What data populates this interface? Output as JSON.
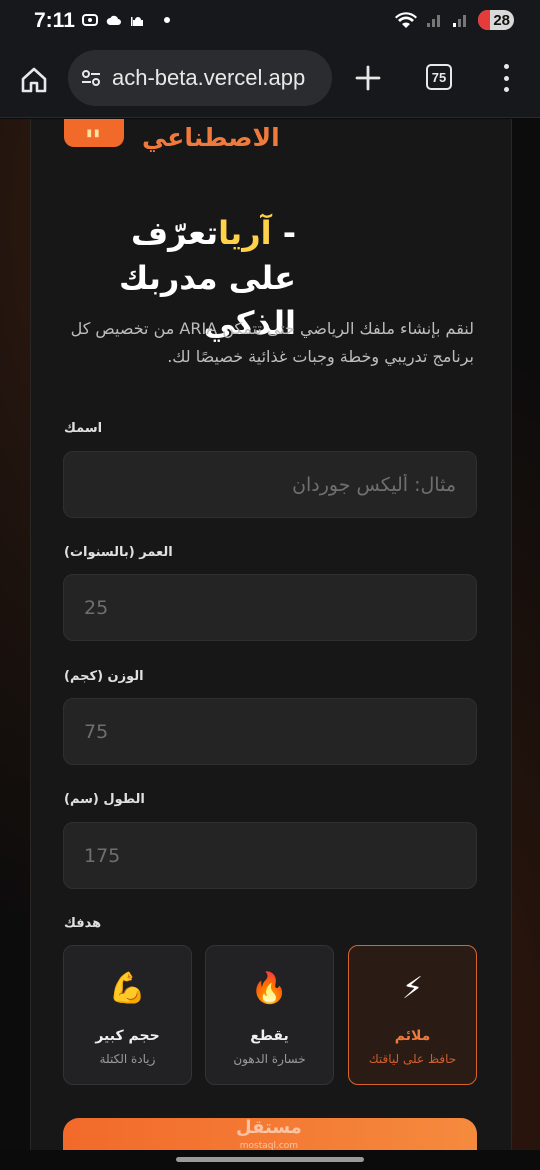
{
  "status_bar": {
    "time": "7:11",
    "battery": "28"
  },
  "browser": {
    "url": "ach-beta.vercel.app",
    "tab_count": "75"
  },
  "brand": {
    "subtitle": "الاصطناعي"
  },
  "hero": {
    "dash": "- ",
    "name": "آريا",
    "title_rest": "تعرّف على مدربك الذكي",
    "description": "لنقم بإنشاء ملفك الرياضي حتى تتمكن ARIA من تخصيص كل برنامج تدريبي وخطة وجبات غذائية خصيصًا لك."
  },
  "form": {
    "name_label": "اسمك",
    "name_placeholder": "مثال: أليكس جوردان",
    "age_label": "العمر (بالسنوات)",
    "age_placeholder": "25",
    "weight_label": "الوزن (كجم)",
    "weight_placeholder": "75",
    "height_label": "الطول (سم)",
    "height_placeholder": "175",
    "goal_label": "هدفك"
  },
  "goals": [
    {
      "emoji": "⚡",
      "title": "ملائم",
      "subtitle": "حافظ على لياقتك",
      "selected": true
    },
    {
      "emoji": "🔥",
      "title": "يقطع",
      "subtitle": "خسارة الدهون",
      "selected": false
    },
    {
      "emoji": "💪",
      "title": "حجم كبير",
      "subtitle": "زيادة الكتلة",
      "selected": false
    }
  ],
  "watermark": {
    "arabic": "مستقل",
    "latin": "mostaql.com"
  },
  "colors": {
    "accent": "#f26a2a",
    "accent_text": "#f07a3c",
    "name_highlight": "#ffd24a"
  },
  "icons": {
    "home": "home-icon",
    "site_settings": "tune-icon",
    "new_tab": "plus-icon",
    "menu": "more-vert-icon"
  }
}
